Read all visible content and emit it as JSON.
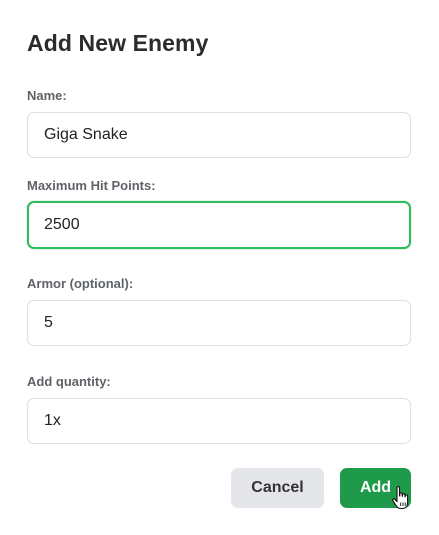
{
  "dialog": {
    "title": "Add New Enemy",
    "fields": {
      "name": {
        "label": "Name:",
        "value": "Giga Snake"
      },
      "max_hp": {
        "label": "Maximum Hit Points:",
        "value": "2500"
      },
      "armor": {
        "label": "Armor (optional):",
        "value": "5"
      },
      "quantity": {
        "label": "Add quantity:",
        "value": "1x"
      }
    },
    "buttons": {
      "cancel_label": "Cancel",
      "add_label": "Add"
    }
  },
  "colors": {
    "accent_green": "#1f9a4a",
    "focus_border": "#2dbb5d",
    "cancel_bg": "#e4e6ea"
  },
  "icons": {
    "cursor": "hand-pointer-icon"
  }
}
